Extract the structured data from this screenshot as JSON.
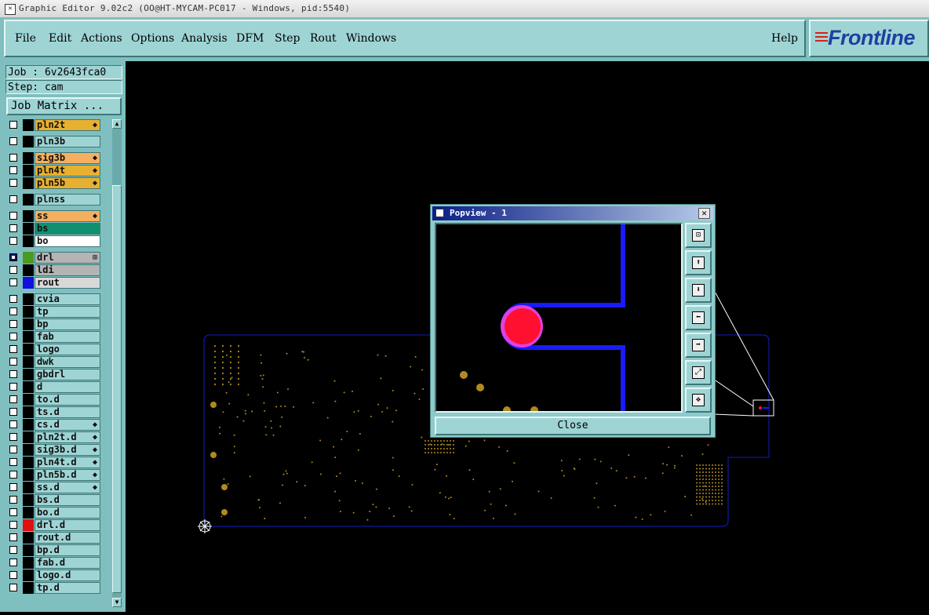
{
  "window": {
    "title": "Graphic Editor 9.02c2 (OO@HT-MYCAM-PC017 - Windows, pid:5540)"
  },
  "menu": {
    "items": [
      "File",
      "Edit",
      "Actions",
      "Options",
      "Analysis",
      "DFM",
      "Step",
      "Rout",
      "Windows"
    ],
    "help": "Help"
  },
  "brand": {
    "logo_text": "Frontline"
  },
  "job": {
    "job_label": "Job : 6v2643fca0",
    "step_label": "Step: cam"
  },
  "job_matrix_button": "Job Matrix ...",
  "layers": [
    {
      "name": "pln2t",
      "color": "#e8b030",
      "swatch": "",
      "mark": "◆",
      "checked": false
    },
    {
      "name": "pln3b",
      "color": "#9fd4d4",
      "swatch": "",
      "mark": "",
      "checked": false
    },
    {
      "name": "sig3b",
      "color": "#f4b060",
      "swatch": "",
      "mark": "◆",
      "checked": false
    },
    {
      "name": "pln4t",
      "color": "#e8b030",
      "swatch": "",
      "mark": "◆",
      "checked": false
    },
    {
      "name": "pln5b",
      "color": "#e8b030",
      "swatch": "",
      "mark": "◆",
      "checked": false
    },
    {
      "name": "plnss",
      "color": "#9fd4d4",
      "swatch": "",
      "mark": "",
      "checked": false
    },
    {
      "name": "ss",
      "color": "#f4b060",
      "swatch": "",
      "mark": "◆",
      "checked": false
    },
    {
      "name": "bs",
      "color": "#109070",
      "swatch": "",
      "mark": "",
      "checked": false
    },
    {
      "name": "bo",
      "color": "#ffffff",
      "swatch": "",
      "mark": "",
      "checked": false
    },
    {
      "name": "drl",
      "color": "#b4b4b4",
      "swatch": "#4a9a20",
      "mark": "⊞",
      "checked": true
    },
    {
      "name": "ldi",
      "color": "#b4b4b4",
      "swatch": "",
      "mark": "",
      "checked": false
    },
    {
      "name": "rout",
      "color": "#d8d8d8",
      "swatch": "#1010e0",
      "mark": "",
      "checked": false
    },
    {
      "name": "cvia",
      "color": "#9fd4d4",
      "swatch": "",
      "mark": "",
      "checked": false
    },
    {
      "name": "tp",
      "color": "#9fd4d4",
      "swatch": "",
      "mark": "",
      "checked": false
    },
    {
      "name": "bp",
      "color": "#9fd4d4",
      "swatch": "",
      "mark": "",
      "checked": false
    },
    {
      "name": "fab",
      "color": "#9fd4d4",
      "swatch": "",
      "mark": "",
      "checked": false
    },
    {
      "name": "logo",
      "color": "#9fd4d4",
      "swatch": "",
      "mark": "",
      "checked": false
    },
    {
      "name": "dwk",
      "color": "#9fd4d4",
      "swatch": "",
      "mark": "",
      "checked": false
    },
    {
      "name": "gbdrl",
      "color": "#9fd4d4",
      "swatch": "",
      "mark": "",
      "checked": false
    },
    {
      "name": "d",
      "color": "#9fd4d4",
      "swatch": "",
      "mark": "",
      "checked": false
    },
    {
      "name": "to.d",
      "color": "#9fd4d4",
      "swatch": "",
      "mark": "",
      "checked": false
    },
    {
      "name": "ts.d",
      "color": "#9fd4d4",
      "swatch": "",
      "mark": "",
      "checked": false
    },
    {
      "name": "cs.d",
      "color": "#9fd4d4",
      "swatch": "",
      "mark": "◆",
      "checked": false
    },
    {
      "name": "pln2t.d",
      "color": "#9fd4d4",
      "swatch": "",
      "mark": "◆",
      "checked": false
    },
    {
      "name": "sig3b.d",
      "color": "#9fd4d4",
      "swatch": "",
      "mark": "◆",
      "checked": false
    },
    {
      "name": "pln4t.d",
      "color": "#9fd4d4",
      "swatch": "",
      "mark": "◆",
      "checked": false
    },
    {
      "name": "pln5b.d",
      "color": "#9fd4d4",
      "swatch": "",
      "mark": "◆",
      "checked": false
    },
    {
      "name": "ss.d",
      "color": "#9fd4d4",
      "swatch": "",
      "mark": "◆",
      "checked": false
    },
    {
      "name": "bs.d",
      "color": "#9fd4d4",
      "swatch": "",
      "mark": "",
      "checked": false
    },
    {
      "name": "bo.d",
      "color": "#9fd4d4",
      "swatch": "",
      "mark": "",
      "checked": false
    },
    {
      "name": "drl.d",
      "color": "#9fd4d4",
      "swatch": "#e01010",
      "mark": "",
      "checked": false
    },
    {
      "name": "rout.d",
      "color": "#9fd4d4",
      "swatch": "",
      "mark": "",
      "checked": false
    },
    {
      "name": "bp.d",
      "color": "#9fd4d4",
      "swatch": "",
      "mark": "",
      "checked": false
    },
    {
      "name": "fab.d",
      "color": "#9fd4d4",
      "swatch": "",
      "mark": "",
      "checked": false
    },
    {
      "name": "logo.d",
      "color": "#9fd4d4",
      "swatch": "",
      "mark": "",
      "checked": false
    },
    {
      "name": "tp.d",
      "color": "#9fd4d4",
      "swatch": "",
      "mark": "",
      "checked": false
    }
  ],
  "popview": {
    "title": "Popview - 1",
    "close_label": "Close",
    "tools": [
      "zoom-window-icon",
      "pan-up-icon",
      "pan-down-icon",
      "pan-left-icon",
      "pan-right-icon",
      "zoom-fit-icon",
      "zoom-home-icon"
    ],
    "tool_glyphs": [
      "⊡",
      "⬆",
      "⬇",
      "⬅",
      "➡",
      "⤢",
      "✥"
    ]
  },
  "colors": {
    "panel": "#9fd4d4",
    "board_outline": "#1020c0",
    "pad": "#b08a20",
    "rout": "#1a1aff",
    "drill": "#ff1030"
  }
}
